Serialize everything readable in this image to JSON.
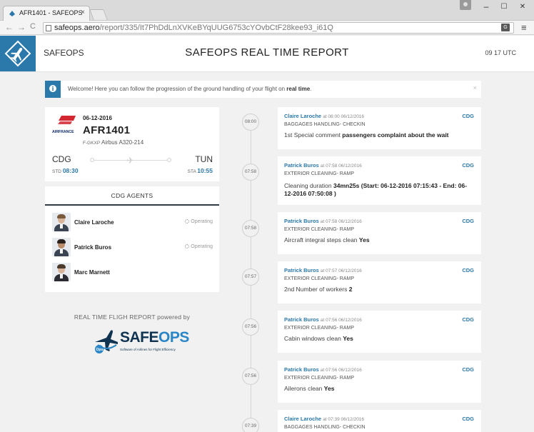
{
  "browser": {
    "tab_title": "AFR1401 - SAFEOPS",
    "tab_close": "×",
    "url_host": "safeops.aero",
    "url_path": "/report/335/It7PhDdLnXVKeBYqUUG6753cYOvbCtF28kee93_i61Q",
    "back": "←",
    "forward": "→",
    "reload": "C",
    "minimize": "–",
    "maximize": "☐",
    "close": "✕",
    "menu": "≡"
  },
  "header": {
    "brand": "SAFEOPS",
    "title": "SAFEOPS REAL TIME REPORT",
    "clock": "09   17 UTC"
  },
  "welcome": {
    "info": "i",
    "message_prefix": "Welcome! Here you can follow the progression of the ground handling of your flight on ",
    "message_bold": "real time",
    "message_suffix": ".",
    "close": "×"
  },
  "flight": {
    "date": "06-12-2016",
    "number": "AFR1401",
    "registration": "F-GKXP",
    "aircraft": "Airbus A320-214",
    "airline_logo_text": "AIRFRANCE",
    "origin": "CDG",
    "destination": "TUN",
    "std_label": "STD",
    "std": "08:30",
    "sta_label": "STA",
    "sta": "10:55"
  },
  "agents": {
    "header": "CDG AGENTS",
    "items": [
      {
        "name": "Claire Laroche",
        "status": "Operating"
      },
      {
        "name": "Patrick Buros",
        "status": "Operating"
      },
      {
        "name": "Marc Marnett",
        "status": ""
      }
    ]
  },
  "powered": {
    "text": "REAL TIME FLIGH REPORT powered by",
    "logo_safe": "SAFE",
    "logo_ops": "OPS",
    "logo_badge": "Ops",
    "logo_tag": "Software of Airlines for Flight Efficiency"
  },
  "timeline": [
    {
      "time": "08:00",
      "agent": "Claire Laroche",
      "stamp": "at 08:00 06/12/2016",
      "airport": "CDG",
      "category": "BAGGAGES HANDLING- CHECKIN",
      "label": "1st Special comment ",
      "value": "passengers complaint about the wait"
    },
    {
      "time": "07:58",
      "agent": "Patrick Buros",
      "stamp": "at 07:58 06/12/2016",
      "airport": "CDG",
      "category": "EXTERIOR CLEANING- RAMP",
      "label": "Cleaning duration ",
      "value": "34mn25s (Start: 06-12-2016 07:15:43 - End: 06-12-2016 07:50:08 )"
    },
    {
      "time": "07:58",
      "agent": "Patrick Buros",
      "stamp": "at 07:58 06/12/2016",
      "airport": "CDG",
      "category": "EXTERIOR CLEANING- RAMP",
      "label": "Aircraft integral steps clean ",
      "value": "Yes"
    },
    {
      "time": "07:57",
      "agent": "Patrick Buros",
      "stamp": "at 07:57 06/12/2016",
      "airport": "CDG",
      "category": "EXTERIOR CLEANING- RAMP",
      "label": "2nd Number of workers ",
      "value": "2"
    },
    {
      "time": "07:56",
      "agent": "Patrick Buros",
      "stamp": "at 07:56 06/12/2016",
      "airport": "CDG",
      "category": "EXTERIOR CLEANING- RAMP",
      "label": "Cabin windows clean ",
      "value": "Yes"
    },
    {
      "time": "07:56",
      "agent": "Patrick Buros",
      "stamp": "at 07:56 06/12/2016",
      "airport": "CDG",
      "category": "EXTERIOR CLEANING- RAMP",
      "label": "Ailerons clean ",
      "value": "Yes"
    },
    {
      "time": "07:39",
      "agent": "Claire Laroche",
      "stamp": "at 07:39 06/12/2016",
      "airport": "CDG",
      "category": "BAGGAGES HANDLING- CHECKIN",
      "label": "",
      "value": ""
    }
  ],
  "colors": {
    "accent": "#2b78aa",
    "background": "#f1f1f1",
    "dark": "#2e3a44"
  }
}
